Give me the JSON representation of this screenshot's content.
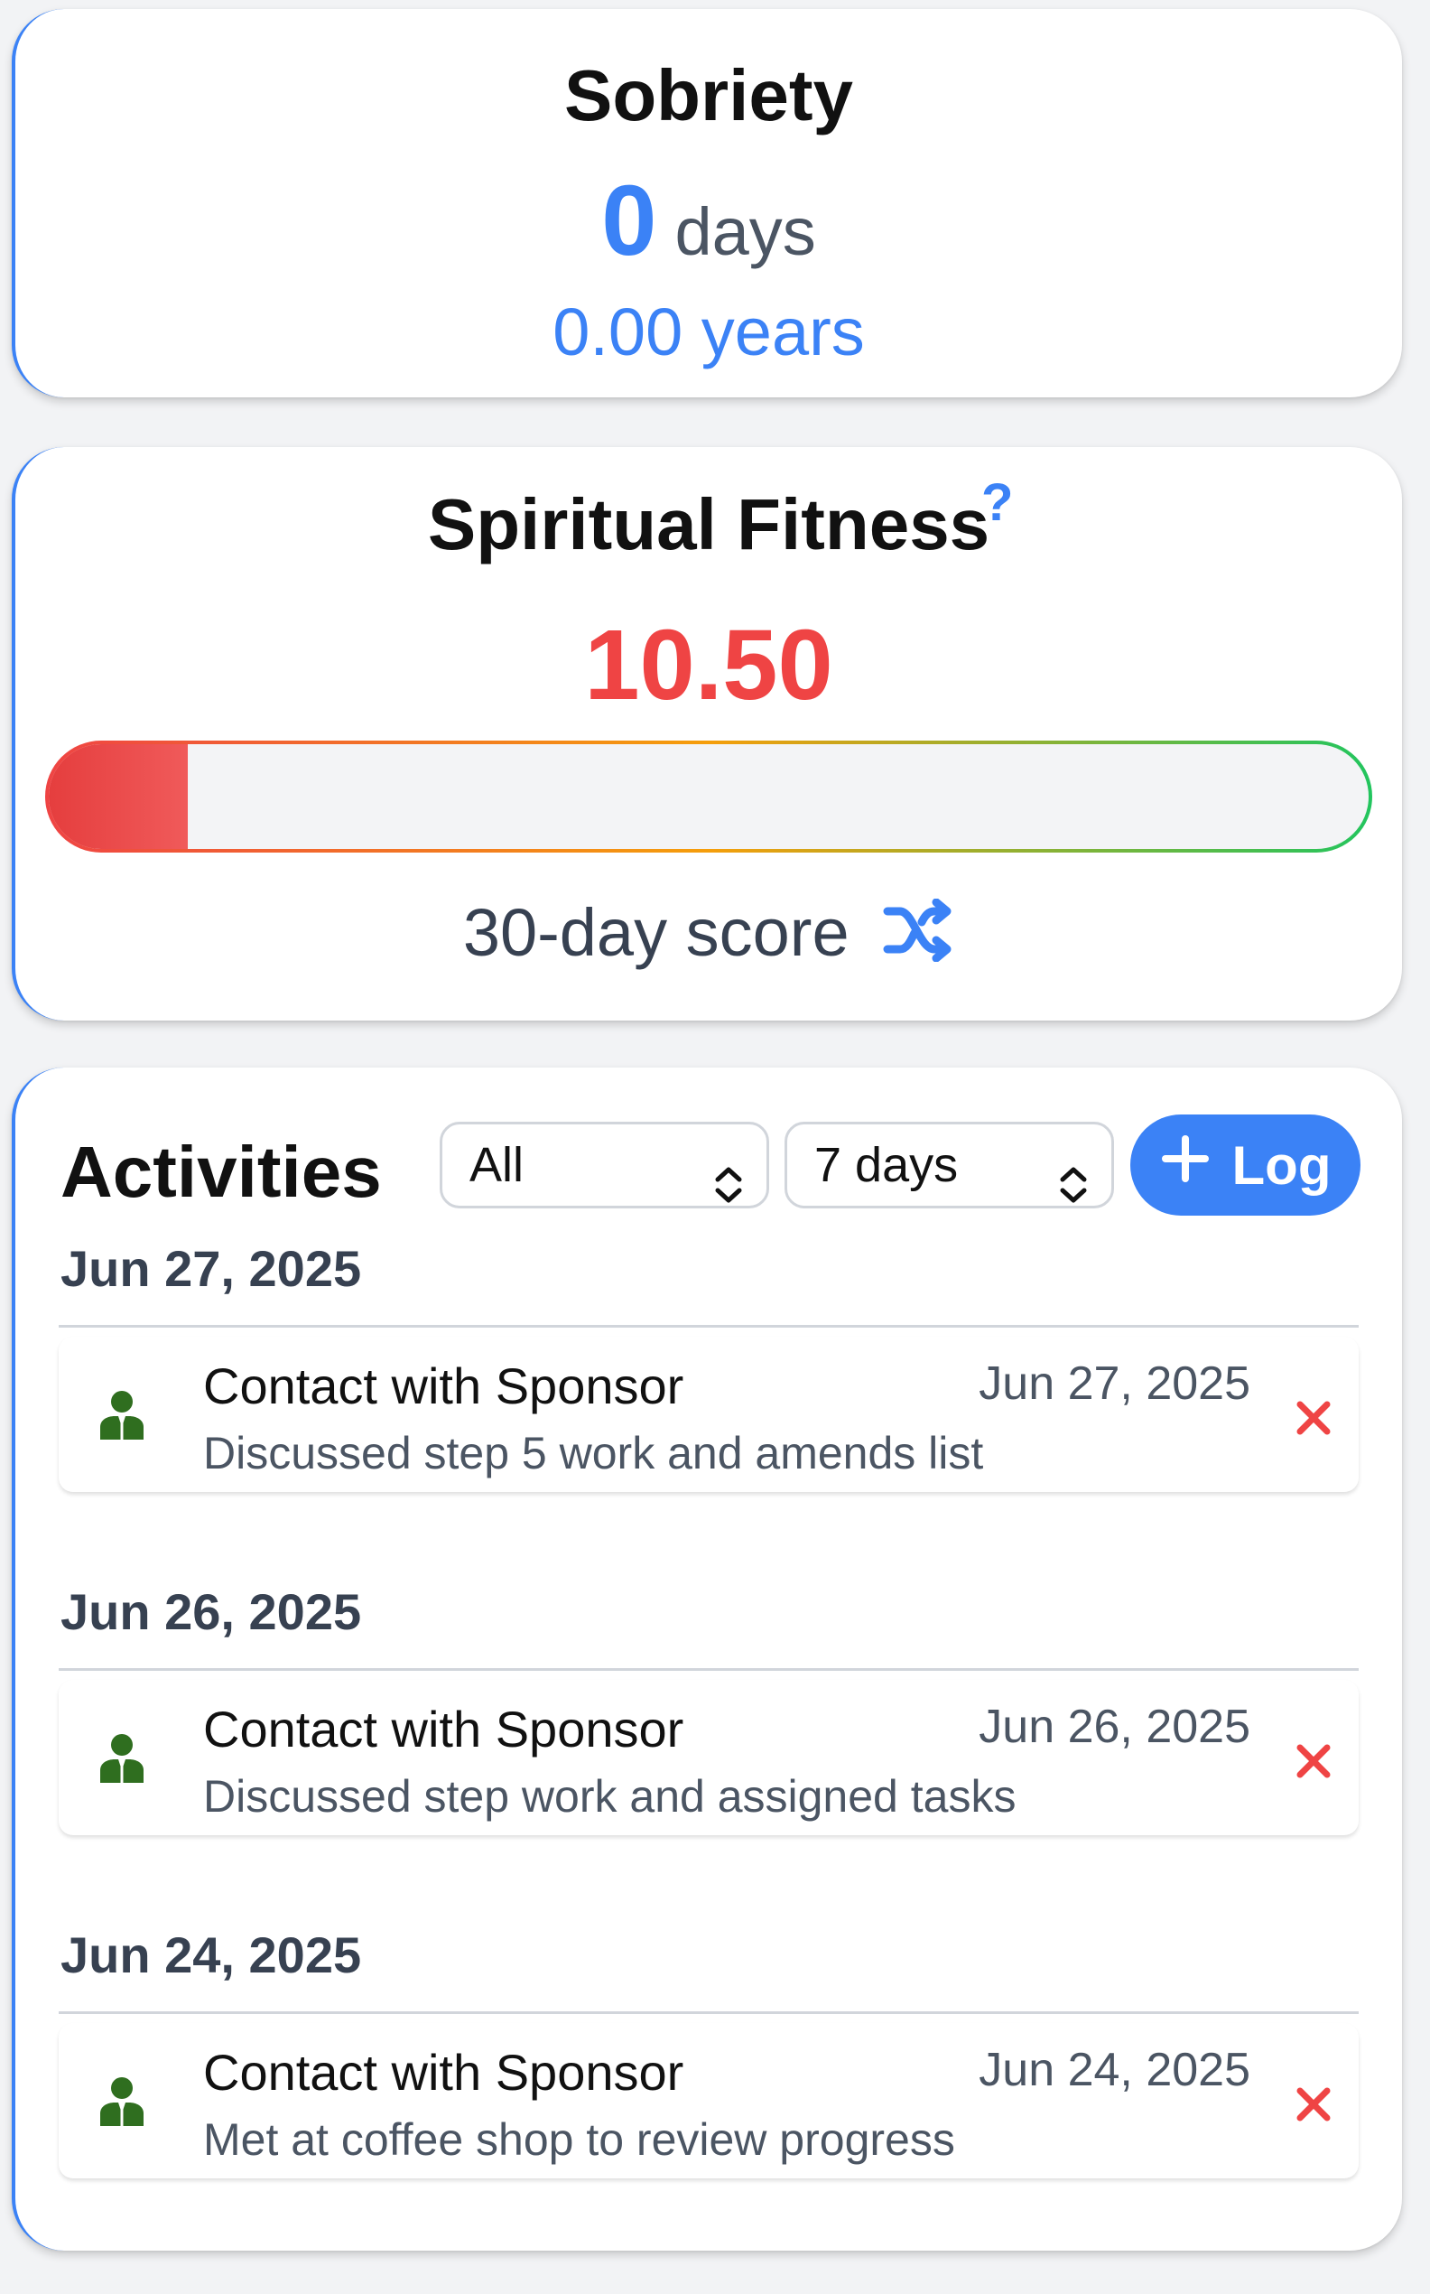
{
  "sobriety": {
    "title": "Sobriety",
    "days_value": "0",
    "days_unit": "days",
    "years": "0.00 years"
  },
  "fitness": {
    "title": "Spiritual Fitness",
    "help": "?",
    "score": "10.50",
    "score_fraction": 0.105,
    "caption": "30-day score",
    "caption_icon": "shuffle-icon"
  },
  "activities": {
    "title": "Activities",
    "filter_type": "All",
    "filter_range": "7 days",
    "log_label": "Log",
    "groups": [
      {
        "date": "Jun 27, 2025",
        "items": [
          {
            "name": "Contact with Sponsor",
            "date": "Jun 27, 2025",
            "note": "Discussed step 5 work and amends list",
            "icon": "sponsor-person-icon"
          }
        ]
      },
      {
        "date": "Jun 26, 2025",
        "items": [
          {
            "name": "Contact with Sponsor",
            "date": "Jun 26, 2025",
            "note": "Discussed step work and assigned tasks",
            "icon": "sponsor-person-icon"
          }
        ]
      },
      {
        "date": "Jun 24, 2025",
        "items": [
          {
            "name": "Contact with Sponsor",
            "date": "Jun 24, 2025",
            "note": "Met at coffee shop to review progress",
            "icon": "sponsor-person-icon"
          }
        ]
      }
    ]
  },
  "colors": {
    "accent": "#3b82f6",
    "score_red": "#ef4444",
    "icon_green": "#2f6e1f",
    "delete_red": "#ef4444"
  }
}
